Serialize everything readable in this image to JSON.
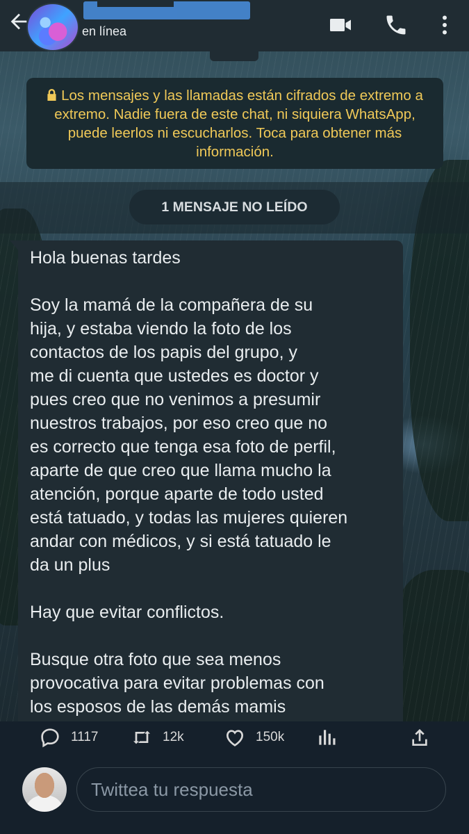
{
  "chat": {
    "status": "en línea",
    "encryption_notice": "Los mensajes y las llamadas están cifrados de extremo a extremo. Nadie fuera de este chat, ni siquiera WhatsApp, puede leerlos ni escucharlos. Toca para obtener más información.",
    "unread_label": "1 MENSAJE NO LEÍDO",
    "message": "Hola buenas tardes\n\nSoy la mamá de la compañera de su\nhija, y estaba viendo la foto de los\ncontactos de los papis del grupo, y\nme di cuenta que ustedes es doctor y\npues creo que no venimos a presumir\nnuestros trabajos, por eso creo que no\nes correcto que tenga esa foto de perfil,\naparte de que creo que llama mucho la\natención, porque aparte de todo usted\nestá tatuado, y todas las mujeres quieren\nandar con médicos, y si está tatuado le\nda un plus\n\nHay que evitar conflictos.\n\nBusque otra foto que sea menos\nprovocativa para evitar problemas con\nlos esposos de las demás mamis",
    "icons": [
      "back-arrow-icon",
      "video-call-icon",
      "phone-icon",
      "more-vertical-icon",
      "lock-icon"
    ],
    "colors": {
      "header": "#202c33",
      "bubble": "#202c33",
      "notice_text": "#f0c958"
    }
  },
  "tweet_actions": {
    "replies": "1117",
    "retweets": "12k",
    "likes": "150k",
    "icons": [
      "reply-icon",
      "retweet-icon",
      "like-icon",
      "analytics-icon",
      "share-icon"
    ]
  },
  "reply_bar": {
    "placeholder": "Twittea tu respuesta"
  },
  "colors": {
    "background": "#15202b",
    "text": "#d9d9d9",
    "placeholder": "#8b98a5"
  }
}
